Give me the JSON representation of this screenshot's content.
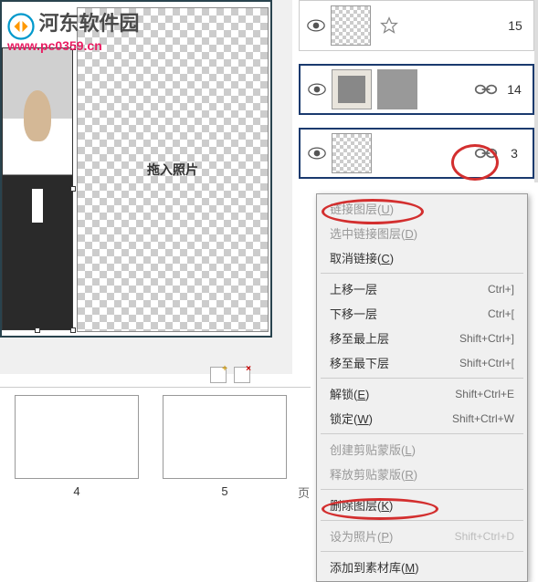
{
  "watermark": {
    "site_name": "河东软件园",
    "url": "www.pc0359.cn"
  },
  "canvas": {
    "placeholder": "拖入照片"
  },
  "layers": [
    {
      "num": "15",
      "has_star": true,
      "has_link": false,
      "type": "empty"
    },
    {
      "num": "14",
      "has_star": false,
      "has_link": true,
      "type": "photo"
    },
    {
      "num": "3",
      "has_star": false,
      "has_link": true,
      "type": "empty"
    }
  ],
  "menu": {
    "link_layer": "链接图层(",
    "link_layer_k": "U",
    "link_layer_end": ")",
    "select_linked": "选中链接图层(",
    "select_linked_k": "D",
    "select_linked_end": ")",
    "unlink": "取消链接(",
    "unlink_k": "C",
    "unlink_end": ")",
    "move_up": "上移一层",
    "move_up_sc": "Ctrl+]",
    "move_down": "下移一层",
    "move_down_sc": "Ctrl+[",
    "to_top": "移至最上层",
    "to_top_sc": "Shift+Ctrl+]",
    "to_bottom": "移至最下层",
    "to_bottom_sc": "Shift+Ctrl+[",
    "unlock": "解锁(",
    "unlock_k": "E",
    "unlock_end": ")",
    "unlock_sc": "Shift+Ctrl+E",
    "lock": "锁定(",
    "lock_k": "W",
    "lock_end": ")",
    "lock_sc": "Shift+Ctrl+W",
    "create_mask": "创建剪贴蒙版(",
    "create_mask_k": "L",
    "create_mask_end": ")",
    "release_mask": "释放剪贴蒙版(",
    "release_mask_k": "R",
    "release_mask_end": ")",
    "delete_layer": "删除图层(",
    "delete_layer_k": "K",
    "delete_layer_end": ")",
    "set_photo": "设为照片(",
    "set_photo_k": "P",
    "set_photo_end": ")",
    "set_photo_sc": "Shift+Ctrl+D",
    "add_library": "添加到素材库(",
    "add_library_k": "M",
    "add_library_end": ")"
  },
  "pages": {
    "p4": "4",
    "p5": "5",
    "label": "页"
  }
}
